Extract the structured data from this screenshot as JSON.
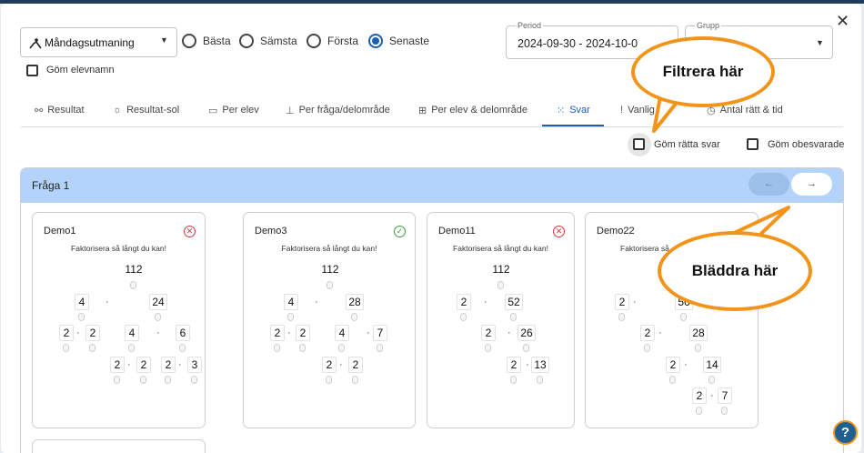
{
  "test_select": {
    "icon": "person-icon",
    "value": "Måndagsutmaning"
  },
  "radios": [
    {
      "label": "Bästa",
      "checked": false
    },
    {
      "label": "Sämsta",
      "checked": false
    },
    {
      "label": "Första",
      "checked": false
    },
    {
      "label": "Senaste",
      "checked": true
    }
  ],
  "hide_names": {
    "label": "Göm elevnamn"
  },
  "period": {
    "label": "Period",
    "value": "2024-09-30 - 2024-10-0"
  },
  "group": {
    "label": "Grupp"
  },
  "tabs": [
    {
      "label": "Resultat",
      "icon": "binoculars-icon"
    },
    {
      "label": "Resultat-sol",
      "icon": "sun-icon"
    },
    {
      "label": "Per elev",
      "icon": "people-icon"
    },
    {
      "label": "Per fråga/delområde",
      "icon": "bar-chart-icon"
    },
    {
      "label": "Per elev & delområde",
      "icon": "grid-icon"
    },
    {
      "label": "Svar",
      "icon": "dots-grid-icon"
    },
    {
      "label": "Vanlig",
      "icon": "exclamation-icon"
    },
    {
      "label": "Antal rätt & tid",
      "icon": "clock-icon"
    }
  ],
  "filters": {
    "hide_correct": "Göm rätta svar",
    "hide_unanswered": "Göm obesvarade"
  },
  "question": {
    "title": "Fråga 1"
  },
  "cards": [
    {
      "name": "Demo1",
      "status": "wrong",
      "status_icon": "✕",
      "prompt": "Faktorisera så långt du kan!",
      "cells": [
        "112",
        "4",
        "24",
        "2",
        "2",
        "4",
        "6",
        "2",
        "2",
        "2",
        "3"
      ]
    },
    {
      "name": "Demo3",
      "status": "right",
      "status_icon": "✓",
      "prompt": "Faktorisera så långt du kan!",
      "cells": [
        "112",
        "4",
        "28",
        "2",
        "2",
        "4",
        "7",
        "2",
        "2"
      ]
    },
    {
      "name": "Demo11",
      "status": "wrong",
      "status_icon": "✕",
      "prompt": "Faktorisera så långt du kan!",
      "cells": [
        "112",
        "2",
        "52",
        "2",
        "26",
        "2",
        "13"
      ]
    },
    {
      "name": "Demo22",
      "prompt": "Faktorisera så",
      "cells": [
        "2",
        "56",
        "2",
        "28",
        "2",
        "14",
        "2",
        "7"
      ]
    }
  ],
  "callouts": {
    "filter": "Filtrera här",
    "browse": "Bläddra här"
  },
  "colors": {
    "accent": "#1a5fb4",
    "header_bg": "#b3d3fa",
    "callout_border": "#f39419",
    "error": "#d9363e",
    "success": "#3d9b3d"
  }
}
